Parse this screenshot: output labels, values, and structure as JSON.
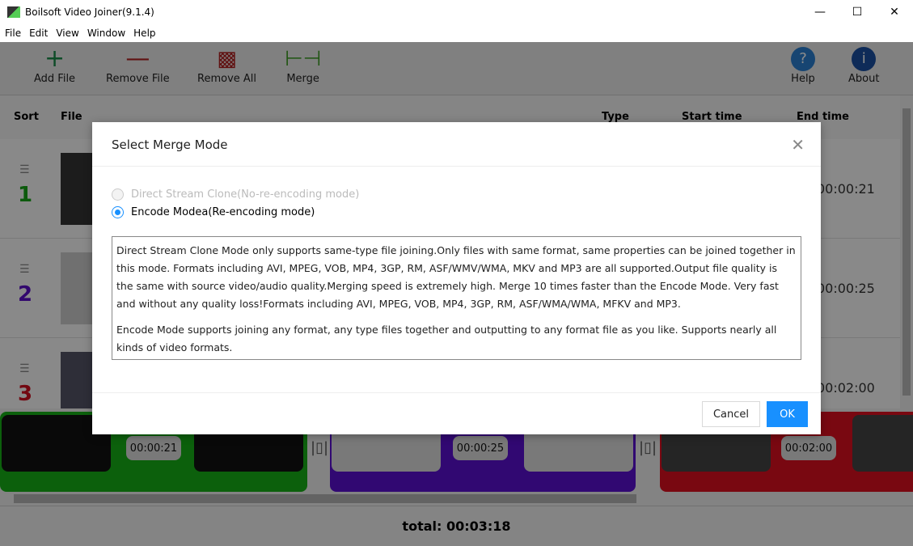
{
  "window": {
    "title": "Boilsoft Video Joiner(9.1.4)"
  },
  "menu": [
    "File",
    "Edit",
    "View",
    "Window",
    "Help"
  ],
  "toolbar": {
    "add": "Add File",
    "remove": "Remove File",
    "remove_all": "Remove All",
    "merge": "Merge",
    "help": "Help",
    "about": "About"
  },
  "columns": {
    "sort": "Sort",
    "file": "File",
    "type": "Type",
    "start": "Start time",
    "end": "End time"
  },
  "rows": [
    {
      "num": "1",
      "end": "00:00:21",
      "color": "#16a516"
    },
    {
      "num": "2",
      "end": "00:00:25",
      "color": "#5b0fc8"
    },
    {
      "num": "3",
      "end": "00:02:00",
      "color": "#d01020"
    }
  ],
  "timeline": [
    {
      "duration": "00:00:21",
      "color": "#0a8a0a"
    },
    {
      "duration": "00:00:25",
      "color": "#3f0090"
    },
    {
      "duration": "00:02:00",
      "color": "#a00010"
    }
  ],
  "total": "total: 00:03:18",
  "dialog": {
    "title": "Select Merge Mode",
    "option1": "Direct Stream Clone(No-re-encoding mode)",
    "option2": "Encode Modea(Re-encoding mode)",
    "selected": "Encode Modea(Re-encoding mode)",
    "desc1": "Direct Stream Clone Mode only supports same-type file joining.Only files with same format, same properties can be joined together in this mode. Formats including AVI, MPEG, VOB, MP4, 3GP, RM, ASF/WMV/WMA, MKV and MP3 are all supported.Output file quality is the same with source video/audio quality.Merging speed is extremely high. Merge 10 times faster than the Encode Mode. Very fast and without any quality loss!Formats including AVI, MPEG, VOB, MP4, 3GP, RM, ASF/WMA/WMA, MFKV and MP3.",
    "desc2": "Encode Mode supports joining any format, any type files together and outputting to any format file as you like. Supports nearly all kinds of video formats.",
    "cancel": "Cancel",
    "ok": "OK"
  }
}
